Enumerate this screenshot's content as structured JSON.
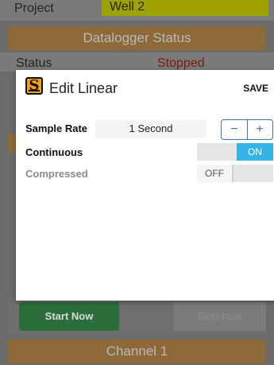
{
  "background": {
    "project_label": "Project",
    "project_value": "Well 2",
    "datalogger_header": "Datalogger Status",
    "status_label": "Status",
    "status_value": "Stopped",
    "start_button": "Start Now",
    "stop_button": "Stop Now",
    "channel_header": "Channel 1"
  },
  "dialog": {
    "title": "Edit Linear",
    "save_label": "SAVE",
    "icon_letter": "S",
    "sample_rate": {
      "label": "Sample Rate",
      "value": "1 Second",
      "minus_label": "−",
      "plus_label": "+"
    },
    "continuous": {
      "label": "Continuous",
      "state_label": "ON",
      "enabled": true
    },
    "compressed": {
      "label": "Compressed",
      "state_label": "OFF",
      "enabled": false
    }
  },
  "colors": {
    "accent_blue": "#35b2e6",
    "stepper_blue": "#3f6fb2",
    "icon_orange": "#f0a019"
  }
}
